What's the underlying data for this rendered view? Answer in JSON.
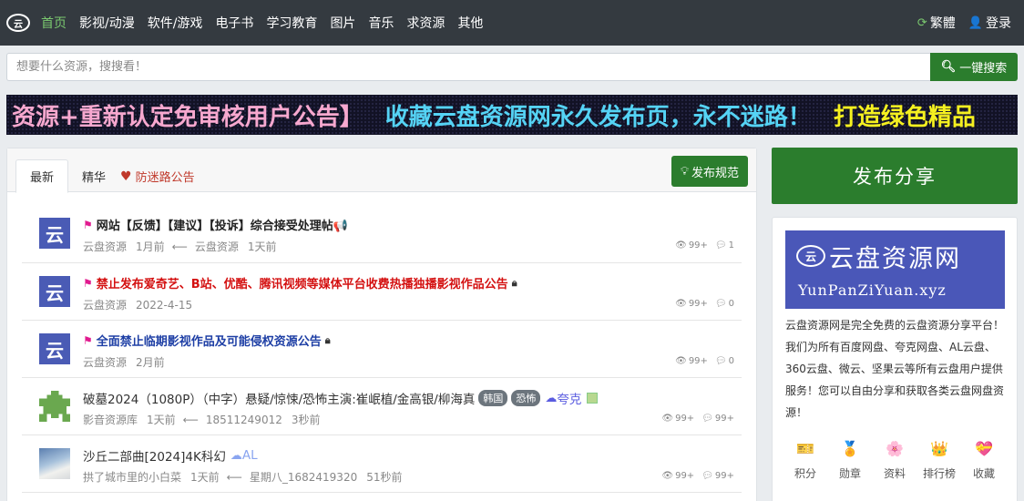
{
  "nav": {
    "logo_text": "云",
    "items": [
      "首页",
      "影视/动漫",
      "软件/游戏",
      "电子书",
      "学习教育",
      "图片",
      "音乐",
      "求资源",
      "其他"
    ],
    "active_index": 0,
    "traditional": "繁體",
    "login": "登录"
  },
  "search": {
    "placeholder": "想要什么资源，搜搜看！",
    "button": "一键搜索"
  },
  "marquee": {
    "part1": "资源+重新认定免审核用户公告】",
    "part2": "收藏云盘资源网永久发布页，永不迷路！",
    "part3": "打造绿色精品"
  },
  "tabs": {
    "latest": "最新",
    "featured": "精华",
    "announcement": "防迷路公告",
    "rules_button": "发布规范"
  },
  "threads": [
    {
      "title": "网站【反馈】【建议】【投诉】综合接受处理帖📢",
      "author": "云盘资源",
      "time": "1月前",
      "last_reply_user": "云盘资源",
      "last_reply_time": "1天前",
      "views": "99+",
      "comments": "1"
    },
    {
      "title": "禁止发布爱奇艺、B站、优酷、腾讯视频等媒体平台收费热播独播影视作品公告",
      "author": "云盘资源",
      "time": "2022-4-15",
      "views": "99+",
      "comments": "0"
    },
    {
      "title": "全面禁止临期影视作品及可能侵权资源公告",
      "author": "云盘资源",
      "time": "2月前",
      "views": "99+",
      "comments": "0"
    },
    {
      "title": "破墓2024（1080P）（中字）悬疑/惊悚/恐怖主演:崔岷植/金高银/柳海真",
      "tags": [
        "韩国",
        "恐怖"
      ],
      "disk": "夸克",
      "author": "影音资源库",
      "time": "1天前",
      "last_reply_user": "18511249012",
      "last_reply_time": "3秒前",
      "views": "99+",
      "comments": "99+"
    },
    {
      "title": "沙丘二部曲[2024]4K科幻",
      "disk": "AL",
      "author": "拱了城市里的小白菜",
      "time": "1天前",
      "last_reply_user": "星期八_1682419320",
      "last_reply_time": "51秒前",
      "views": "99+",
      "comments": "99+"
    }
  ],
  "sidebar": {
    "publish": "发布分享",
    "brand_name": "云盘资源网",
    "brand_url": "YunPanZiYuan.xyz",
    "description": "云盘资源网是完全免费的云盘资源分享平台！我们为所有百度网盘、夸克网盘、AL云盘、360云盘、微云、坚果云等所有云盘用户提供服务！您可以自由分享和获取各类云盘网盘资源！",
    "icons": [
      {
        "label": "积分",
        "icon": "🎫"
      },
      {
        "label": "勋章",
        "icon": "🏅"
      },
      {
        "label": "资料",
        "icon": "🌸"
      },
      {
        "label": "排行榜",
        "icon": "👑"
      },
      {
        "label": "收藏",
        "icon": "💝"
      }
    ]
  },
  "colors": {
    "nav_bg": "#343a40",
    "accent_green": "#2b7d2d",
    "active_nav": "#7bc96f",
    "brand_blue": "#4a57b8"
  }
}
